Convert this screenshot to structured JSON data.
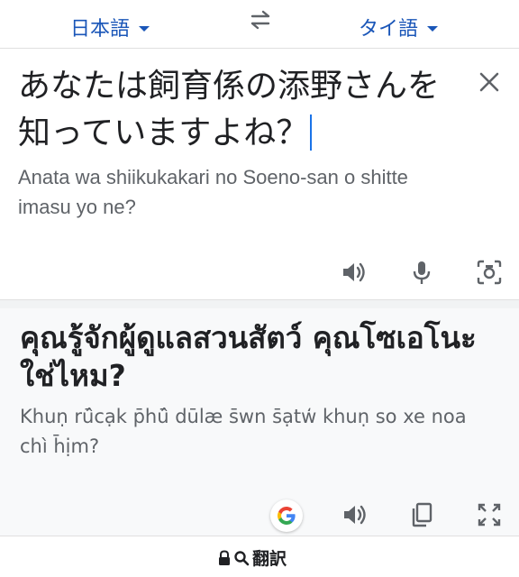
{
  "languages": {
    "source": "日本語",
    "target": "タイ語"
  },
  "source": {
    "text": "あなたは飼育係の添野さんを知っていますよね？",
    "romanization": "Anata wa shiikukakari no Soeno-san o shitte imasu yo ne?"
  },
  "result": {
    "text": "คุณรู้จักผู้ดูแลสวนสัตว์ คุณโซเอโนะ ใช่ไหม?",
    "romanization": "Khuṇ rū̂cạk p̄hū̂ dūlæ s̄wn s̄ạtw̒ khuṇ so xe noa chı̀ h̄ịm?"
  },
  "footer": {
    "label": "翻訳"
  },
  "icons": {
    "swap": "swap-arrows-icon",
    "close": "close-icon",
    "speaker": "speaker-icon",
    "mic": "mic-icon",
    "camera": "camera-icon",
    "google": "google-logo-icon",
    "copy": "copy-icon",
    "fullscreen": "fullscreen-icon",
    "lock": "lock-icon",
    "search": "search-icon"
  },
  "colors": {
    "accent": "#1a56b8",
    "text": "#202124",
    "muted": "#5f6368",
    "icon": "#5f6368"
  }
}
